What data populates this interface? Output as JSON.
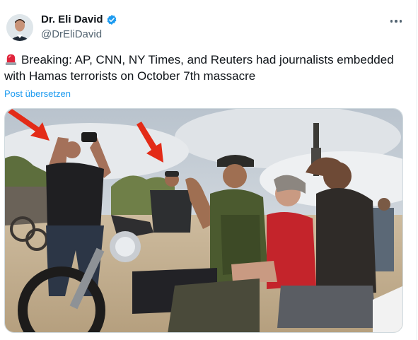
{
  "author": {
    "display_name": "Dr. Eli David",
    "handle": "@DrEliDavid",
    "verified": true
  },
  "tweet": {
    "text": "Breaking: AP, CNN, NY Times, and Reuters had journalists embedded with Hamas terrorists on October 7th massacre",
    "translate_label": "Post übersetzen",
    "leading_emoji": "siren-icon"
  },
  "colors": {
    "link": "#1d9bf0",
    "verified": "#1d9bf0",
    "muted": "#536471",
    "annotation_arrow": "#e32b17"
  },
  "icons": {
    "more": "more-horizontal-icon",
    "verified": "verified-badge-icon"
  }
}
